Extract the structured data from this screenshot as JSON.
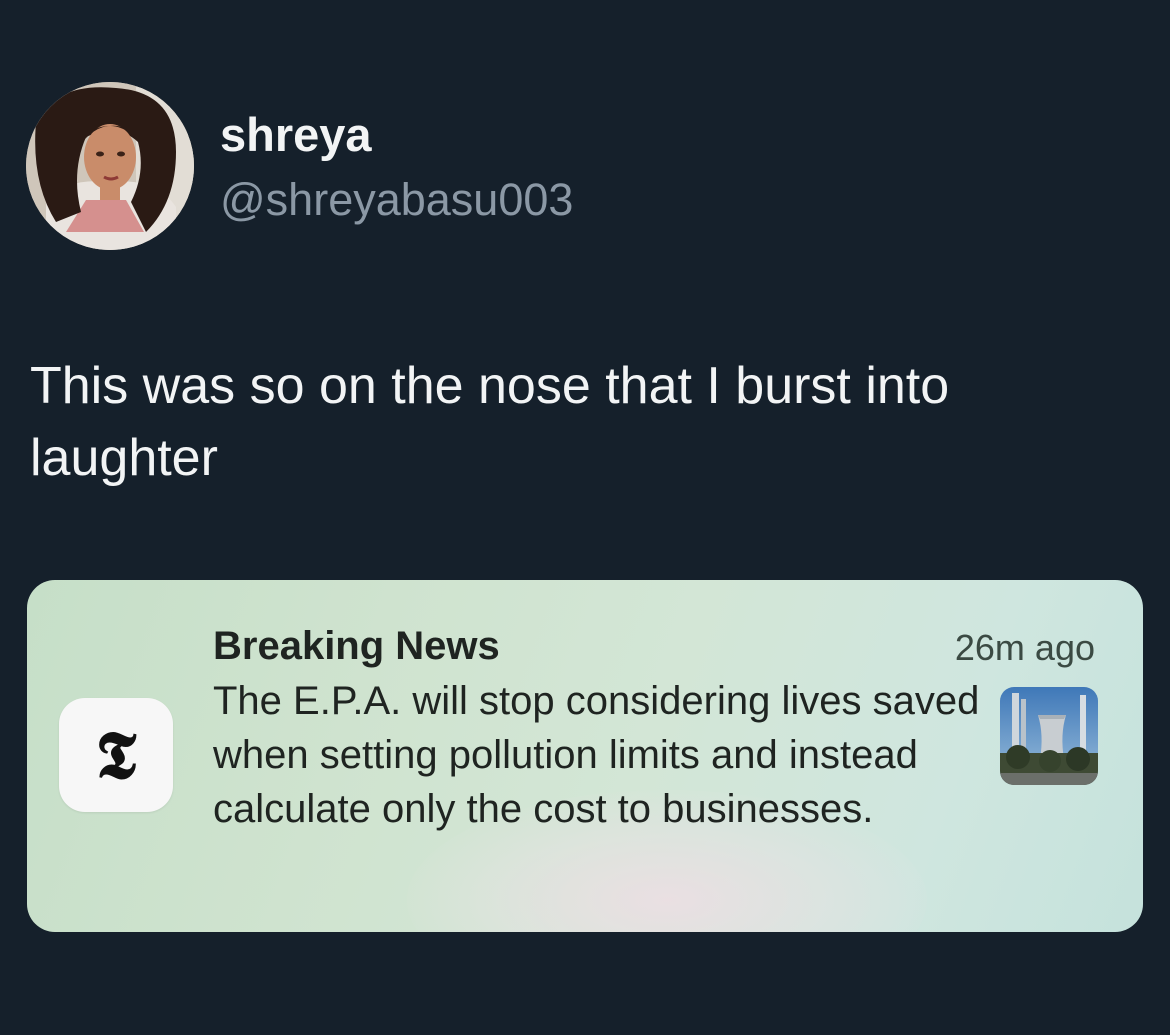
{
  "user": {
    "display_name": "shreya",
    "handle": "@shreyabasu003",
    "avatar_icon": "profile-photo"
  },
  "tweet": {
    "text": "This was so on the nose that I burst into laughter"
  },
  "notification": {
    "app_icon": "nyt-logo-icon",
    "app_glyph": "𝕿",
    "title": "Breaking News",
    "time": "26m ago",
    "body": "The E.P.A. will stop considering lives saved when setting pollution limits and instead calculate only the cost to businesses.",
    "thumbnail_icon": "power-plant-thumbnail"
  },
  "colors": {
    "background": "#15202b",
    "primary_text": "#f2f4f5",
    "secondary_text": "#8b98a5",
    "notification_text": "#1f2421"
  }
}
